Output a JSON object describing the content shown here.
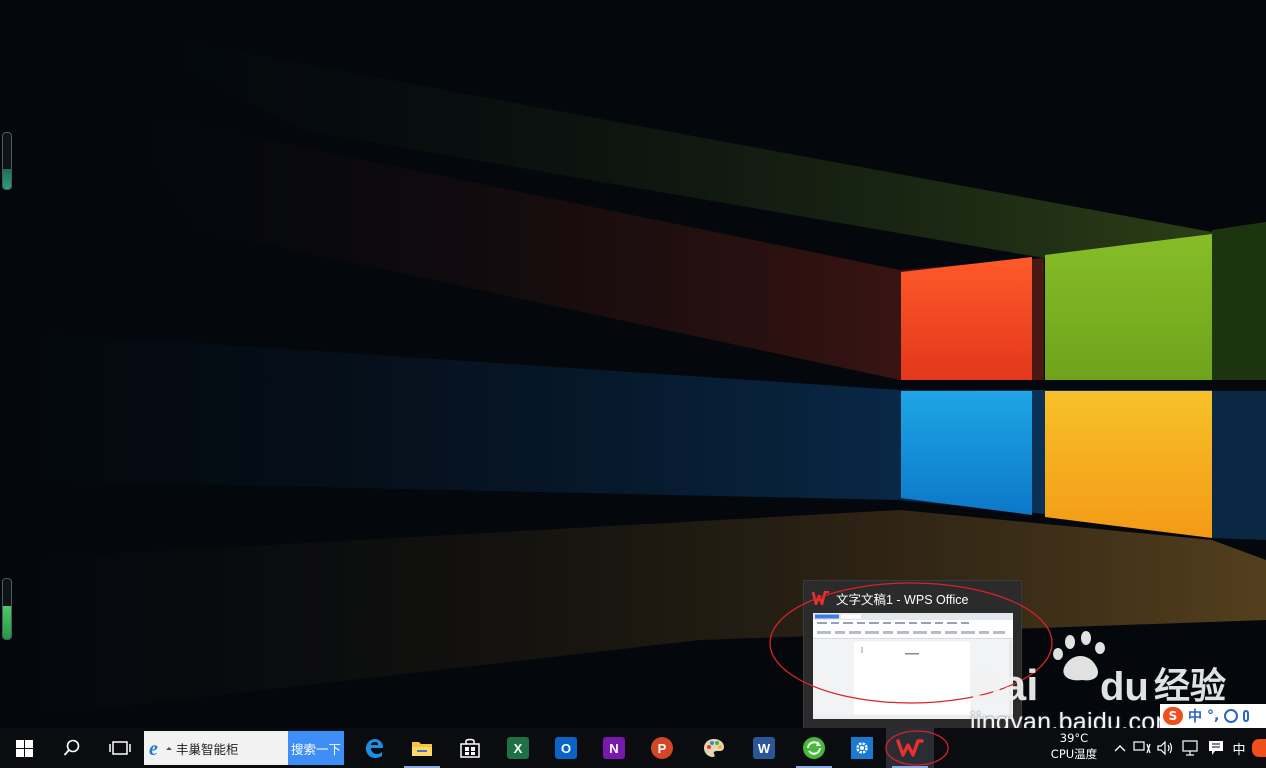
{
  "thumbnail": {
    "title": "文字文稿1 - WPS Office"
  },
  "taskbar": {
    "search_text": "丰巢智能柜",
    "search_button": "搜索一下",
    "apps": [
      {
        "name": "edge",
        "icon": "edge-icon"
      },
      {
        "name": "file-explorer",
        "icon": "folder-icon"
      },
      {
        "name": "store",
        "icon": "store-icon"
      },
      {
        "name": "excel",
        "icon": "excel-icon",
        "letter": "X"
      },
      {
        "name": "outlook",
        "icon": "outlook-icon",
        "letter": "O"
      },
      {
        "name": "onenote",
        "icon": "onenote-icon",
        "letter": "N"
      },
      {
        "name": "powerpoint",
        "icon": "powerpoint-icon",
        "letter": "P"
      },
      {
        "name": "paint",
        "icon": "palette-icon"
      },
      {
        "name": "word",
        "icon": "word-icon",
        "letter": "W"
      },
      {
        "name": "browser",
        "icon": "refresh-globe-icon"
      },
      {
        "name": "settings",
        "icon": "gear-icon"
      },
      {
        "name": "wps",
        "icon": "wps-icon"
      }
    ],
    "cpu_temp_value": "39°C",
    "cpu_temp_label": "CPU温度",
    "ime_label": "中"
  },
  "watermark": {
    "logo_text": "Bai du 经验",
    "url": "jingyan.baidu.com",
    "ime_text": "中"
  },
  "gauges": {
    "top_level": 0.35,
    "bottom_level": 0.55
  },
  "colors": {
    "taskbar_bg": "#0a0c10",
    "search_button_bg": "#3e8ef7",
    "wps_red": "#e8302e",
    "excel_green": "#1e7145",
    "outlook_blue": "#0a64c8",
    "onenote_purple": "#7719aa",
    "powerpoint_orange": "#d24726",
    "word_blue": "#2b579a"
  }
}
